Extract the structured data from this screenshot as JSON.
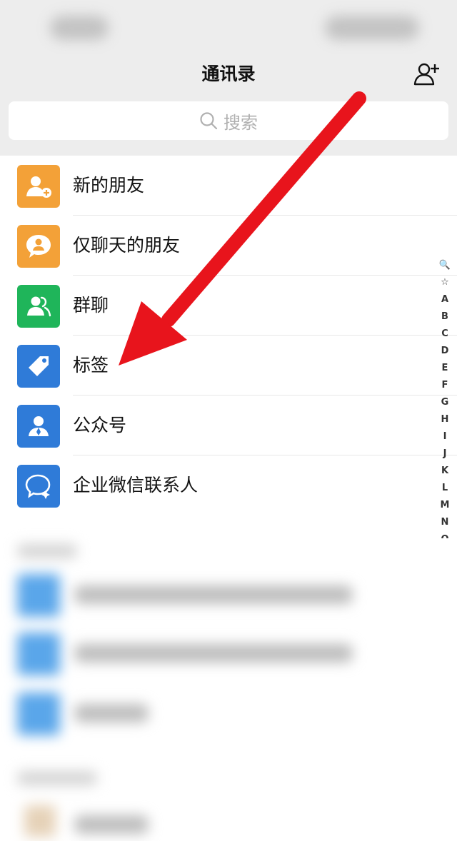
{
  "header": {
    "title": "通讯录",
    "add_contact_icon": "add-contact-icon"
  },
  "search": {
    "placeholder": "搜索"
  },
  "menu": [
    {
      "label": "新的朋友",
      "icon": "new-friend-icon",
      "color": "#f3a138"
    },
    {
      "label": "仅聊天的朋友",
      "icon": "chat-only-friend-icon",
      "color": "#f3a138"
    },
    {
      "label": "群聊",
      "icon": "group-chat-icon",
      "color": "#1fb55a"
    },
    {
      "label": "标签",
      "icon": "tag-icon",
      "color": "#2f7bd8"
    },
    {
      "label": "公众号",
      "icon": "official-account-icon",
      "color": "#2f7bd8"
    },
    {
      "label": "企业微信联系人",
      "icon": "work-contact-icon",
      "color": "#2f7bd8"
    }
  ],
  "index": [
    "🔍",
    "☆",
    "A",
    "B",
    "C",
    "D",
    "E",
    "F",
    "G",
    "H",
    "I",
    "J",
    "K",
    "L",
    "M",
    "N",
    "O"
  ],
  "colors": {
    "arrow": "#e8141c",
    "background_top": "#ededed",
    "blurred_avatar": "#5aa6ea"
  }
}
